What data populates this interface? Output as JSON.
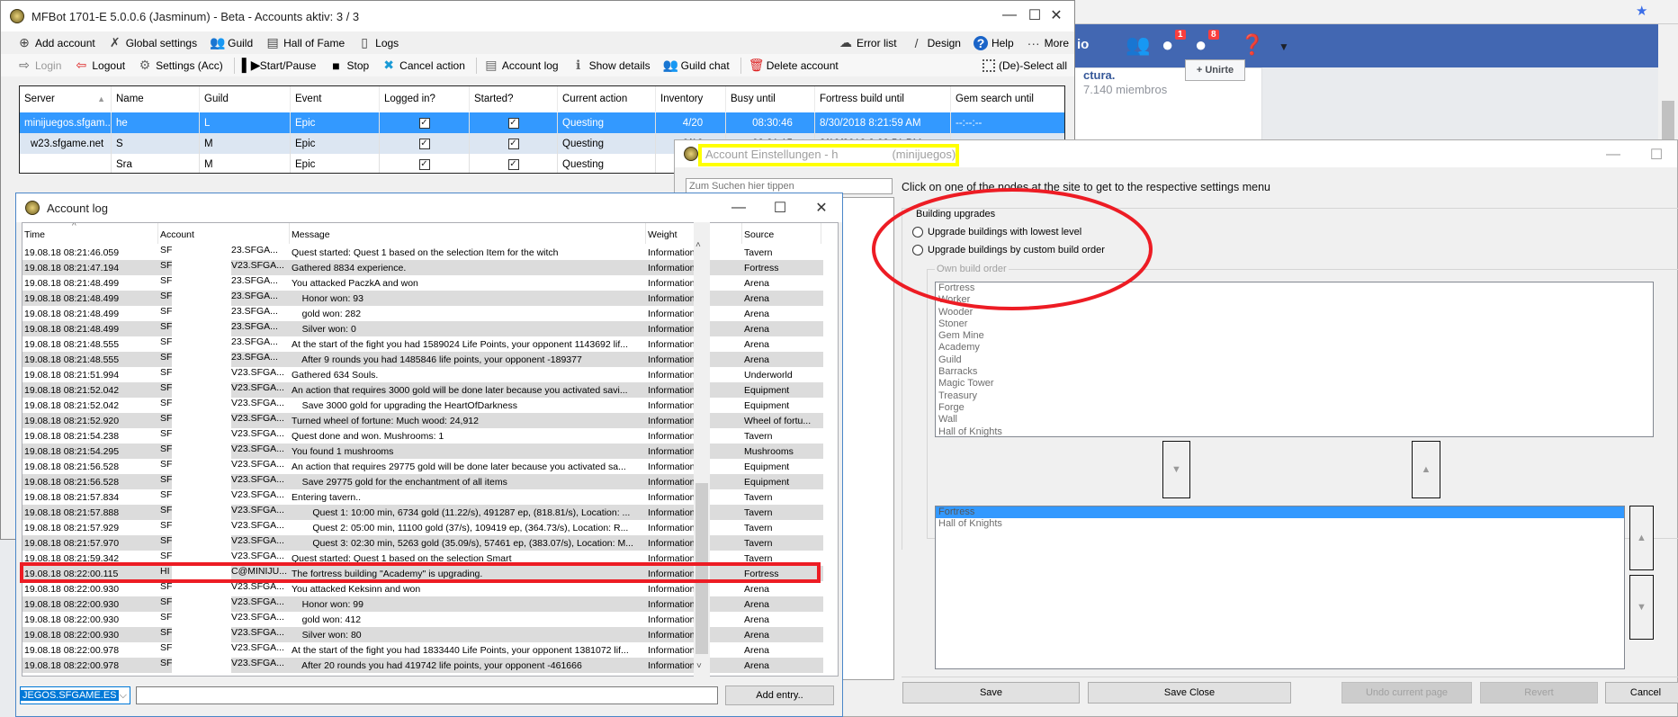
{
  "browser": {
    "fb_tab_text": "io",
    "group_name": "ctura.",
    "members": "7.140 miembros",
    "join_button": "+ Unirte",
    "messages_badge": "1",
    "notifications_badge": "8",
    "brand_color": "#4267b2"
  },
  "main": {
    "title": "MFBot 1701-E 5.0.0.6 (Jasminum) - Beta  - Accounts aktiv: 3 / 3",
    "menu_left": [
      {
        "label": "Add account",
        "icon": "add-circle-icon",
        "glyph": "⊕"
      },
      {
        "label": "Global settings",
        "icon": "tools-icon",
        "glyph": "✗"
      },
      {
        "label": "Guild",
        "icon": "guild-icon",
        "glyph": "👥"
      },
      {
        "label": "Hall of Fame",
        "icon": "list-icon",
        "glyph": "▤"
      },
      {
        "label": "Logs",
        "icon": "document-icon",
        "glyph": "▯"
      }
    ],
    "menu_right": [
      {
        "label": "Error list",
        "icon": "cloud-icon",
        "glyph": "☁"
      },
      {
        "label": "Design",
        "icon": "brush-icon",
        "glyph": "/"
      },
      {
        "label": "Help",
        "icon": "help-icon",
        "glyph": "?"
      },
      {
        "label": "More",
        "icon": "more-icon",
        "glyph": "···"
      }
    ],
    "actions": [
      {
        "label": "Login",
        "icon": "login-icon",
        "glyph": "⇨"
      },
      {
        "label": "Logout",
        "icon": "logout-icon",
        "glyph": "⇦"
      },
      {
        "label": "Settings (Acc)",
        "icon": "gear-icon",
        "glyph": "⚙"
      },
      {
        "label": "Start/Pause",
        "icon": "play-pause-icon",
        "glyph": "▌▶"
      },
      {
        "label": "Stop",
        "icon": "stop-icon",
        "glyph": "■"
      },
      {
        "label": "Cancel action",
        "icon": "cancel-icon",
        "glyph": "✖"
      },
      {
        "label": "Account log",
        "icon": "document-icon",
        "glyph": "▤"
      },
      {
        "label": "Show details",
        "icon": "info-icon",
        "glyph": "ℹ"
      },
      {
        "label": "Guild chat",
        "icon": "guild-chat-icon",
        "glyph": "👥"
      },
      {
        "label": "Delete account",
        "icon": "trash-icon",
        "glyph": "🗑"
      }
    ],
    "select_all": "(De)-Select all",
    "columns": [
      "Server",
      "Name",
      "Guild",
      "Event",
      "Logged in?",
      "Started?",
      "Current action",
      "Inventory",
      "Busy until",
      "Fortress build until",
      "Gem search until"
    ],
    "rows": [
      {
        "server": "minijuegos.sfgam...",
        "name": "he",
        "guild": "L",
        "event": "Epic",
        "logged_in": true,
        "started": true,
        "action": "Questing",
        "inventory": "4/20",
        "busy": "08:30:46",
        "fortress": "8/30/2018 8:21:59 AM",
        "gem": "--:--:--"
      },
      {
        "server": "w23.sfgame.net",
        "name": "S",
        "guild": "M",
        "event": "Epic",
        "logged_in": true,
        "started": true,
        "action": "Questing",
        "inventory": "0/16",
        "busy": "08:31:15",
        "fortress": "8/19/2018 8:22:51 PM",
        "gem": ""
      },
      {
        "server": "",
        "name": "Sra",
        "guild": "M",
        "event": "Epic",
        "logged_in": true,
        "started": true,
        "action": "Questing",
        "inventory": "",
        "busy": "",
        "fortress": "",
        "gem": ""
      }
    ]
  },
  "settings": {
    "title": "Account Einstellungen - h",
    "title_server": "(minijuegos)",
    "search_placeholder": "Zum Suchen hier tippen",
    "hint": "Click on one of the nodes at the site to get to the respective settings menu",
    "group_label": "Building upgrades",
    "radio_lowest": "Upgrade buildings with lowest level",
    "radio_custom": "Upgrade buildings by custom build order",
    "own_order_label": "Own build order",
    "buildings": [
      "Fortress",
      "Worker",
      "Wooder",
      "Stoner",
      "Gem Mine",
      "Academy",
      "Guild",
      "Barracks",
      "Magic Tower",
      "Treasury",
      "Forge",
      "Wall",
      "Hall of Knights"
    ],
    "order": [
      "Fortress",
      "Hall of Knights"
    ],
    "selected_order_index": 0,
    "buttons": {
      "save": "Save",
      "save_close": "Save  Close",
      "undo": "Undo current page",
      "revert": "Revert",
      "cancel": "Cancel"
    },
    "highlight_color": "#ffff00",
    "annotation_color": "#ed1c24"
  },
  "log": {
    "title": "Account log",
    "columns": [
      "Time",
      "Account",
      "Message",
      "Weight",
      "Source"
    ],
    "rows": [
      [
        "19.08.18 08:21:46.059",
        "SF",
        "23.SFGA...",
        "Quest started: Quest 1 based on the selection Item for the witch",
        "Information",
        "Tavern"
      ],
      [
        "19.08.18 08:21:47.194",
        "SF",
        "V23.SFGA...",
        "Gathered 8834 experience.",
        "Information",
        "Fortress"
      ],
      [
        "19.08.18 08:21:48.499",
        "SF",
        "23.SFGA...",
        "You attacked PaczkA and won",
        "Information",
        "Arena"
      ],
      [
        "19.08.18 08:21:48.499",
        "SF",
        "23.SFGA...",
        "    Honor won: 93",
        "Information",
        "Arena"
      ],
      [
        "19.08.18 08:21:48.499",
        "SF",
        "23.SFGA...",
        "    gold won: 282",
        "Information",
        "Arena"
      ],
      [
        "19.08.18 08:21:48.499",
        "SF",
        "23.SFGA...",
        "    Silver won: 0",
        "Information",
        "Arena"
      ],
      [
        "19.08.18 08:21:48.555",
        "SF",
        "23.SFGA...",
        "At the start of the fight you had 1589024 Life Points, your opponent 1143692 lif...",
        "Information",
        "Arena"
      ],
      [
        "19.08.18 08:21:48.555",
        "SF",
        "23.SFGA...",
        "    After 9 rounds you had 1485846 life points, your opponent -189377",
        "Information",
        "Arena"
      ],
      [
        "19.08.18 08:21:51.994",
        "SF",
        "V23.SFGA...",
        "Gathered 634 Souls.",
        "Information",
        "Underworld"
      ],
      [
        "19.08.18 08:21:52.042",
        "SF",
        "V23.SFGA...",
        "An action that requires 3000 gold will be done later because you activated savi...",
        "Information",
        "Equipment"
      ],
      [
        "19.08.18 08:21:52.042",
        "SF",
        "V23.SFGA...",
        "    Save 3000 gold for upgrading the HeartOfDarkness",
        "Information",
        "Equipment"
      ],
      [
        "19.08.18 08:21:52.920",
        "SF",
        "V23.SFGA...",
        "Turned wheel of fortune: Much wood: 24,912",
        "Information",
        "Wheel of fortu..."
      ],
      [
        "19.08.18 08:21:54.238",
        "SF",
        "V23.SFGA...",
        "Quest done and won. Mushrooms: 1",
        "Information",
        "Tavern"
      ],
      [
        "19.08.18 08:21:54.295",
        "SF",
        "V23.SFGA...",
        "You found 1 mushrooms",
        "Information",
        "Mushrooms"
      ],
      [
        "19.08.18 08:21:56.528",
        "SF",
        "V23.SFGA...",
        "An action that requires 29775 gold will be done later because you activated sa...",
        "Information",
        "Equipment"
      ],
      [
        "19.08.18 08:21:56.528",
        "SF",
        "V23.SFGA...",
        "    Save 29775 gold for the enchantment of all items",
        "Information",
        "Equipment"
      ],
      [
        "19.08.18 08:21:57.834",
        "SF",
        "V23.SFGA...",
        "Entering tavern..",
        "Information",
        "Tavern"
      ],
      [
        "19.08.18 08:21:57.888",
        "SF",
        "V23.SFGA...",
        "        Quest 1: 10:00 min, 6734 gold (11.22/s), 491287 ep, (818.81/s), Location: ...",
        "Information",
        "Tavern"
      ],
      [
        "19.08.18 08:21:57.929",
        "SF",
        "V23.SFGA...",
        "        Quest 2: 05:00 min, 11100 gold (37/s), 109419 ep, (364.73/s), Location: R...",
        "Information",
        "Tavern"
      ],
      [
        "19.08.18 08:21:57.970",
        "SF",
        "V23.SFGA...",
        "        Quest 3: 02:30 min, 5263 gold (35.09/s), 57461 ep, (383.07/s), Location: M...",
        "Information",
        "Tavern"
      ],
      [
        "19.08.18 08:21:59.342",
        "SF",
        "V23.SFGA...",
        "Quest started: Quest 1 based on the selection Smart",
        "Information",
        "Tavern"
      ],
      [
        "19.08.18 08:22:00.115",
        "HI",
        "C@MINIJU...",
        "The fortress building \"Academy\" is upgrading.",
        "Information",
        "Fortress"
      ],
      [
        "19.08.18 08:22:00.930",
        "SF",
        "V23.SFGA...",
        "You attacked Keksinn and won",
        "Information",
        "Arena"
      ],
      [
        "19.08.18 08:22:00.930",
        "SF",
        "V23.SFGA...",
        "    Honor won: 99",
        "Information",
        "Arena"
      ],
      [
        "19.08.18 08:22:00.930",
        "SF",
        "V23.SFGA...",
        "    gold won: 412",
        "Information",
        "Arena"
      ],
      [
        "19.08.18 08:22:00.930",
        "SF",
        "V23.SFGA...",
        "    Silver won: 80",
        "Information",
        "Arena"
      ],
      [
        "19.08.18 08:22:00.978",
        "SF",
        "V23.SFGA...",
        "At the start of the fight you had 1833440 Life Points, your opponent 1381072 lif...",
        "Information",
        "Arena"
      ],
      [
        "19.08.18 08:22:00.978",
        "SF",
        "V23.SFGA...",
        "    After 20 rounds you had 419742 life points, your opponent -461666",
        "Information",
        "Arena"
      ]
    ],
    "highlighted_row_index": 21,
    "server_select": "JEGOS.SFGAME.ES",
    "entry_input": "",
    "add_entry": "Add entry.."
  }
}
